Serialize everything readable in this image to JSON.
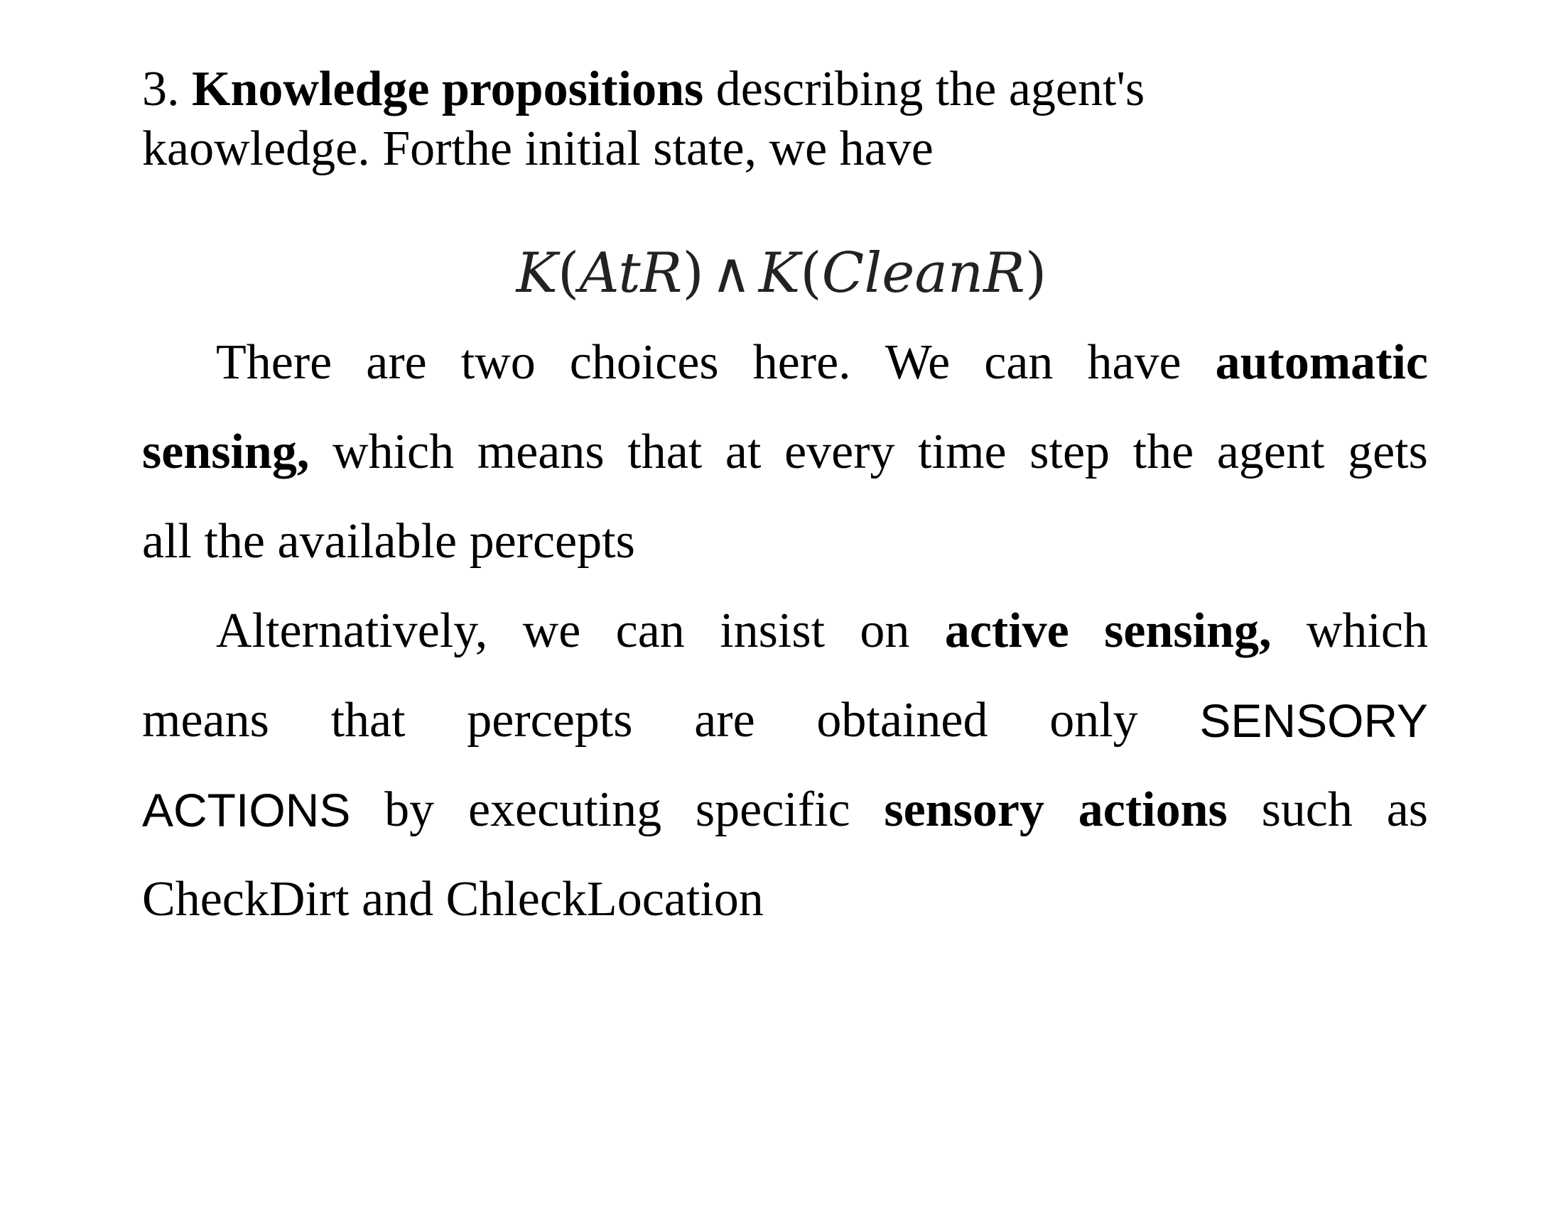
{
  "heading": {
    "number": "3.",
    "term": "Knowledge propositions",
    "rest_line1": "describing the agent's",
    "line2": "kaowledge. Forthe initial state, we have"
  },
  "formula": {
    "k1": "K",
    "open1": "(",
    "arg1": "AtR",
    "close1": ")",
    "and_op": "∧",
    "k2": "K",
    "open2": "(",
    "arg2": "CleanR",
    "close2": ")"
  },
  "paragraph1": {
    "line1_words": [
      "There",
      "are",
      "two",
      "choices",
      "here.",
      "We",
      "can",
      "have"
    ],
    "line1_bold": "automatic",
    "line2_bold": "sensing,",
    "line2_words": [
      "which",
      "means",
      "that",
      "at",
      "every",
      "time",
      "step",
      "the",
      "agent",
      "gets"
    ],
    "line3": "all the available percepts"
  },
  "paragraph2": {
    "line1_words": [
      "Alternatively,",
      "we",
      "can",
      "insist",
      "on"
    ],
    "line1_bold": [
      "active",
      "sensing,"
    ],
    "line1_end": "which",
    "line2_words": [
      "means",
      "that",
      "percepts",
      "are",
      "obtained",
      "only"
    ],
    "line2_sans": "SENSORY",
    "line3_sans": "ACTIONS",
    "line3_words": [
      "by",
      "executing",
      "specific"
    ],
    "line3_bold": [
      "sensory",
      "actions"
    ],
    "line3_end": [
      "such",
      "as"
    ],
    "line4": "CheckDirt and ChleckLocation"
  }
}
